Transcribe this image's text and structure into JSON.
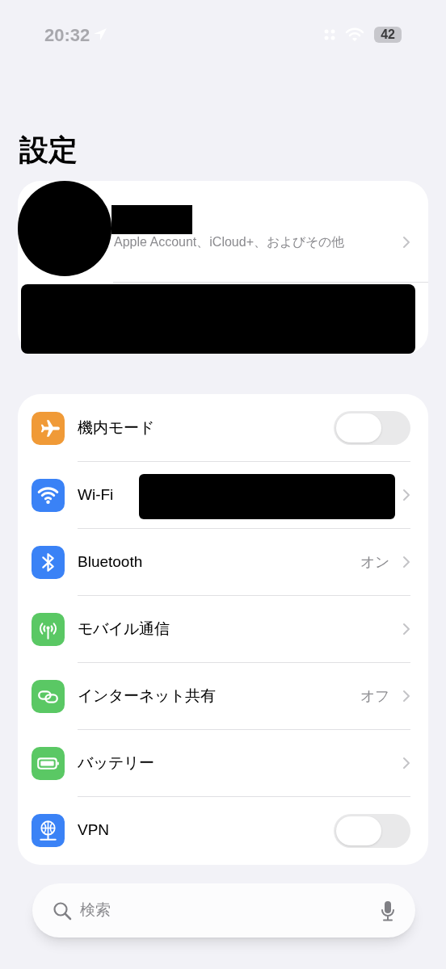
{
  "status_bar": {
    "time": "20:32",
    "battery": "42"
  },
  "title": "設定",
  "account": {
    "subtitle": "Apple Account、iCloud+、およびその他",
    "name_redacted": true,
    "banner_redacted": true
  },
  "settings": [
    {
      "label": "機内モード",
      "kind": "toggle",
      "on": false
    },
    {
      "label": "Wi-Fi",
      "kind": "link",
      "redacted": true
    },
    {
      "label": "Bluetooth",
      "kind": "link",
      "value": "オン"
    },
    {
      "label": "モバイル通信",
      "kind": "link"
    },
    {
      "label": "インターネット共有",
      "kind": "link",
      "value": "オフ"
    },
    {
      "label": "バッテリー",
      "kind": "link"
    },
    {
      "label": "VPN",
      "kind": "toggle",
      "on": false
    }
  ],
  "search": {
    "placeholder": "検索"
  }
}
